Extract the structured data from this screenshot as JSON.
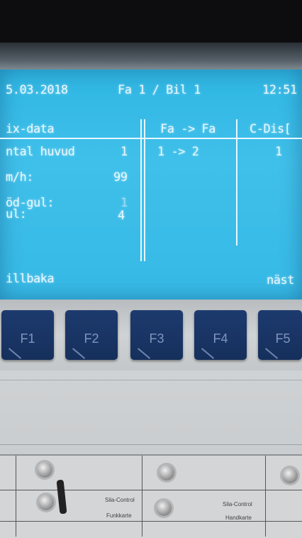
{
  "screen": {
    "date": "5.03.2018",
    "location": "Fa 1 / Bil 1",
    "time": "12:51",
    "col1_header": "ix-data",
    "col2_header": "Fa -> Fa",
    "col3_header": "C-Dis[",
    "rows": [
      {
        "label": "ntal huvud",
        "value": "1",
        "transfer": "1 -> 2",
        "cdis": "1"
      },
      {
        "label": "m/h:",
        "value": "99"
      },
      {
        "label": "öd-gul:",
        "value": "1"
      },
      {
        "label": "ul:",
        "value": "4"
      }
    ],
    "left_softkey": "illbaka",
    "right_softkey": "näst"
  },
  "keys": [
    "F1",
    "F2",
    "F3",
    "F4",
    "F5"
  ],
  "labels": {
    "card1": "Sila-Control",
    "card1_sub": "Funkkarte",
    "card2": "Sila-Control",
    "card2_sub": "Handkarte"
  }
}
